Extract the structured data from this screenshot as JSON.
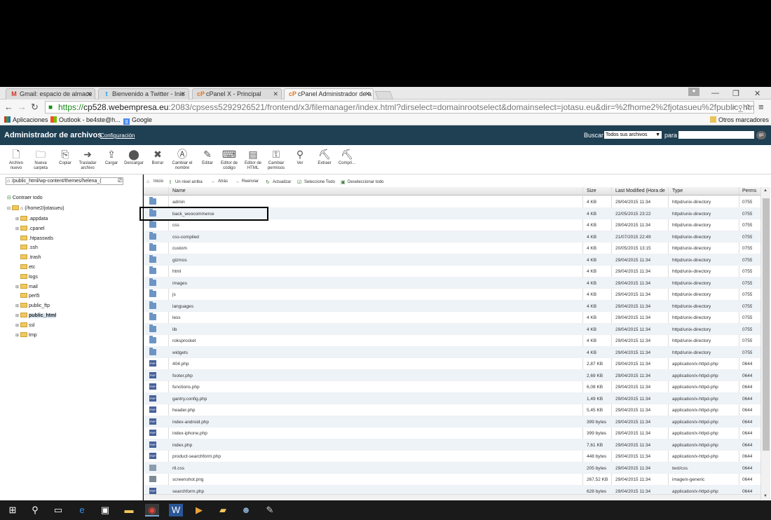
{
  "browser": {
    "tabs": [
      {
        "icon": "M",
        "title": "Gmail: espacio de almace"
      },
      {
        "icon": "t",
        "title": "Bienvenido a Twitter - Inic"
      },
      {
        "icon": "cP",
        "title": "cPanel X - Principal"
      },
      {
        "icon": "cP",
        "title": "cPanel Administrador de a"
      }
    ],
    "url": {
      "scheme": "https://",
      "host": "cp528.webempresa.eu",
      "rest": ":2083/cpsess5292926521/frontend/x3/filemanager/index.html?dirselect=domainrootselect&domainselect=jotasu.eu&dir=%2fhome2%2fjotasueu%2fpublic_html&sho"
    },
    "bookmarks": {
      "apps": "Aplicaciones",
      "outlook": "Outlook - be4ste@h...",
      "google": "Google",
      "others": "Otros marcadores"
    }
  },
  "cpanel": {
    "title": "Administrador de archivos",
    "config_link": "Configuración",
    "search_label": "Buscar",
    "search_scope": "Todos sus archivos",
    "para_label": "para",
    "go_label": "go"
  },
  "toolbar": [
    {
      "label": "Archivo nuevo",
      "icon": "new-file-icon"
    },
    {
      "label": "Nueva carpeta",
      "icon": "new-folder-icon"
    },
    {
      "label": "Copiar",
      "icon": "copy-icon"
    },
    {
      "label": "Trasladar archivo",
      "icon": "move-icon"
    },
    {
      "label": "Cargar",
      "icon": "upload-icon"
    },
    {
      "label": "Descargar",
      "icon": "download-icon"
    },
    {
      "label": "Borrar",
      "icon": "delete-icon"
    },
    {
      "label": "Cambiar el nombre",
      "icon": "rename-icon"
    },
    {
      "label": "Editar",
      "icon": "edit-icon"
    },
    {
      "label": "Editor de código",
      "icon": "code-editor-icon"
    },
    {
      "label": "Editor de HTML",
      "icon": "html-editor-icon"
    },
    {
      "label": "Cambiar permisos",
      "icon": "permissions-icon"
    },
    {
      "label": "Ver",
      "icon": "view-icon"
    },
    {
      "label": "Extraer",
      "icon": "extract-icon"
    },
    {
      "label": "Compri...",
      "icon": "compress-icon"
    }
  ],
  "left": {
    "path": "/public_html/wp-content/themes/helena_(",
    "collapse_label": "Contraer todo",
    "root": "(/home2/jotasueu)",
    "tree": [
      {
        "name": ".appdata",
        "exp": "+"
      },
      {
        "name": ".cpanel",
        "exp": "+"
      },
      {
        "name": ".htpasswds",
        "exp": ""
      },
      {
        "name": ".ssh",
        "exp": ""
      },
      {
        "name": ".trash",
        "exp": ""
      },
      {
        "name": "etc",
        "exp": ""
      },
      {
        "name": "logs",
        "exp": ""
      },
      {
        "name": "mail",
        "exp": "+"
      },
      {
        "name": "perl5",
        "exp": ""
      },
      {
        "name": "public_ftp",
        "exp": "+"
      },
      {
        "name": "public_html",
        "exp": "+",
        "selected": true
      },
      {
        "name": "ssl",
        "exp": "+"
      },
      {
        "name": "tmp",
        "exp": "+"
      }
    ]
  },
  "nav": [
    {
      "label": "Inicio"
    },
    {
      "label": "Un nivel arriba"
    },
    {
      "label": "Atrás"
    },
    {
      "label": "Reenviar"
    },
    {
      "label": "Actualizar"
    },
    {
      "label": "Seleccione Todo"
    },
    {
      "label": "Deseleccionar todo"
    }
  ],
  "columns": {
    "name": "Name",
    "size": "Size",
    "modified": "Last Modified (Hora de",
    "type": "Type",
    "perms": "Perms"
  },
  "files": [
    {
      "name": "admin",
      "size": "4 KB",
      "modified": "29/04/2015 11:34",
      "type": "httpd/unix-directory",
      "perms": "0755",
      "kind": "dir"
    },
    {
      "name": "back_woocommerce",
      "size": "4 KB",
      "modified": "22/05/2015 23:22",
      "type": "httpd/unix-directory",
      "perms": "0755",
      "kind": "dir"
    },
    {
      "name": "css",
      "size": "4 KB",
      "modified": "29/04/2015 11:34",
      "type": "httpd/unix-directory",
      "perms": "0755",
      "kind": "dir"
    },
    {
      "name": "css-compiled",
      "size": "4 KB",
      "modified": "21/07/2015 22:49",
      "type": "httpd/unix-directory",
      "perms": "0755",
      "kind": "dir"
    },
    {
      "name": "custom",
      "size": "4 KB",
      "modified": "20/05/2015 13:15",
      "type": "httpd/unix-directory",
      "perms": "0755",
      "kind": "dir"
    },
    {
      "name": "gizmos",
      "size": "4 KB",
      "modified": "29/04/2015 11:34",
      "type": "httpd/unix-directory",
      "perms": "0755",
      "kind": "dir"
    },
    {
      "name": "html",
      "size": "4 KB",
      "modified": "29/04/2015 11:34",
      "type": "httpd/unix-directory",
      "perms": "0755",
      "kind": "dir"
    },
    {
      "name": "images",
      "size": "4 KB",
      "modified": "29/04/2015 11:34",
      "type": "httpd/unix-directory",
      "perms": "0755",
      "kind": "dir"
    },
    {
      "name": "js",
      "size": "4 KB",
      "modified": "29/04/2015 11:34",
      "type": "httpd/unix-directory",
      "perms": "0755",
      "kind": "dir"
    },
    {
      "name": "languages",
      "size": "4 KB",
      "modified": "29/04/2015 11:34",
      "type": "httpd/unix-directory",
      "perms": "0755",
      "kind": "dir"
    },
    {
      "name": "less",
      "size": "4 KB",
      "modified": "29/04/2015 11:34",
      "type": "httpd/unix-directory",
      "perms": "0755",
      "kind": "dir"
    },
    {
      "name": "lib",
      "size": "4 KB",
      "modified": "29/04/2015 11:34",
      "type": "httpd/unix-directory",
      "perms": "0755",
      "kind": "dir"
    },
    {
      "name": "roksprocket",
      "size": "4 KB",
      "modified": "29/04/2015 11:34",
      "type": "httpd/unix-directory",
      "perms": "0755",
      "kind": "dir"
    },
    {
      "name": "widgets",
      "size": "4 KB",
      "modified": "29/04/2015 11:34",
      "type": "httpd/unix-directory",
      "perms": "0755",
      "kind": "dir"
    },
    {
      "name": "404.php",
      "size": "2,87 KB",
      "modified": "29/04/2015 11:34",
      "type": "application/x-httpd-php",
      "perms": "0644",
      "kind": "php"
    },
    {
      "name": "footer.php",
      "size": "2,69 KB",
      "modified": "29/04/2015 11:34",
      "type": "application/x-httpd-php",
      "perms": "0644",
      "kind": "php"
    },
    {
      "name": "functions.php",
      "size": "6,08 KB",
      "modified": "29/04/2015 11:34",
      "type": "application/x-httpd-php",
      "perms": "0644",
      "kind": "php"
    },
    {
      "name": "gantry.config.php",
      "size": "1,49 KB",
      "modified": "29/04/2015 11:34",
      "type": "application/x-httpd-php",
      "perms": "0644",
      "kind": "php"
    },
    {
      "name": "header.php",
      "size": "5,45 KB",
      "modified": "29/04/2015 11:34",
      "type": "application/x-httpd-php",
      "perms": "0644",
      "kind": "php"
    },
    {
      "name": "index-android.php",
      "size": "399 bytes",
      "modified": "29/04/2015 11:34",
      "type": "application/x-httpd-php",
      "perms": "0644",
      "kind": "php"
    },
    {
      "name": "index-iphone.php",
      "size": "399 bytes",
      "modified": "29/04/2015 11:34",
      "type": "application/x-httpd-php",
      "perms": "0644",
      "kind": "php"
    },
    {
      "name": "index.php",
      "size": "7,61 KB",
      "modified": "29/04/2015 11:34",
      "type": "application/x-httpd-php",
      "perms": "0644",
      "kind": "php"
    },
    {
      "name": "product-searchform.php",
      "size": "448 bytes",
      "modified": "29/04/2015 11:34",
      "type": "application/x-httpd-php",
      "perms": "0644",
      "kind": "php"
    },
    {
      "name": "rtl.css",
      "size": "205 bytes",
      "modified": "29/04/2015 11:34",
      "type": "text/css",
      "perms": "0644",
      "kind": "css"
    },
    {
      "name": "screenshot.png",
      "size": "267,52 KB",
      "modified": "29/04/2015 11:34",
      "type": "image/x-generic",
      "perms": "0644",
      "kind": "png"
    },
    {
      "name": "searchform.php",
      "size": "628 bytes",
      "modified": "29/04/2015 11:34",
      "type": "application/x-httpd-php",
      "perms": "0644",
      "kind": "php"
    }
  ]
}
